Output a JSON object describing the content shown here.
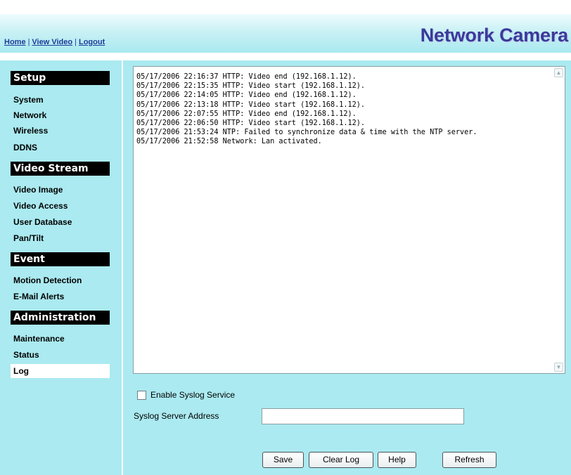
{
  "header": {
    "links": [
      "Home",
      "View Video",
      "Logout"
    ],
    "brand": "Network Camera"
  },
  "sidebar": {
    "sections": [
      {
        "title": "Setup",
        "items": [
          "System",
          "Network",
          "Wireless",
          "DDNS"
        ]
      },
      {
        "title": "Video Stream",
        "items": [
          "Video Image",
          "Video Access",
          "User Database",
          "Pan/Tilt"
        ]
      },
      {
        "title": "Event",
        "items": [
          "Motion Detection",
          "E-Mail Alerts"
        ]
      },
      {
        "title": "Administration",
        "items": [
          "Maintenance",
          "Status",
          "Log"
        ]
      }
    ],
    "active_item": "Log"
  },
  "log": {
    "lines": [
      "05/17/2006 22:16:37 HTTP: Video end (192.168.1.12).",
      "05/17/2006 22:15:35 HTTP: Video start (192.168.1.12).",
      "05/17/2006 22:14:05 HTTP: Video end (192.168.1.12).",
      "05/17/2006 22:13:18 HTTP: Video start (192.168.1.12).",
      "05/17/2006 22:07:55 HTTP: Video end (192.168.1.12).",
      "05/17/2006 22:06:50 HTTP: Video start (192.168.1.12).",
      "05/17/2006 21:53:24 NTP: Failed to synchronize data & time with the NTP server.",
      "05/17/2006 21:52:58 Network: Lan activated."
    ]
  },
  "syslog": {
    "enable_label": "Enable Syslog Service",
    "enabled": false,
    "address_label": "Syslog Server Address",
    "address_value": ""
  },
  "buttons": {
    "save": "Save",
    "clear_log": "Clear Log",
    "help": "Help",
    "refresh": "Refresh"
  }
}
